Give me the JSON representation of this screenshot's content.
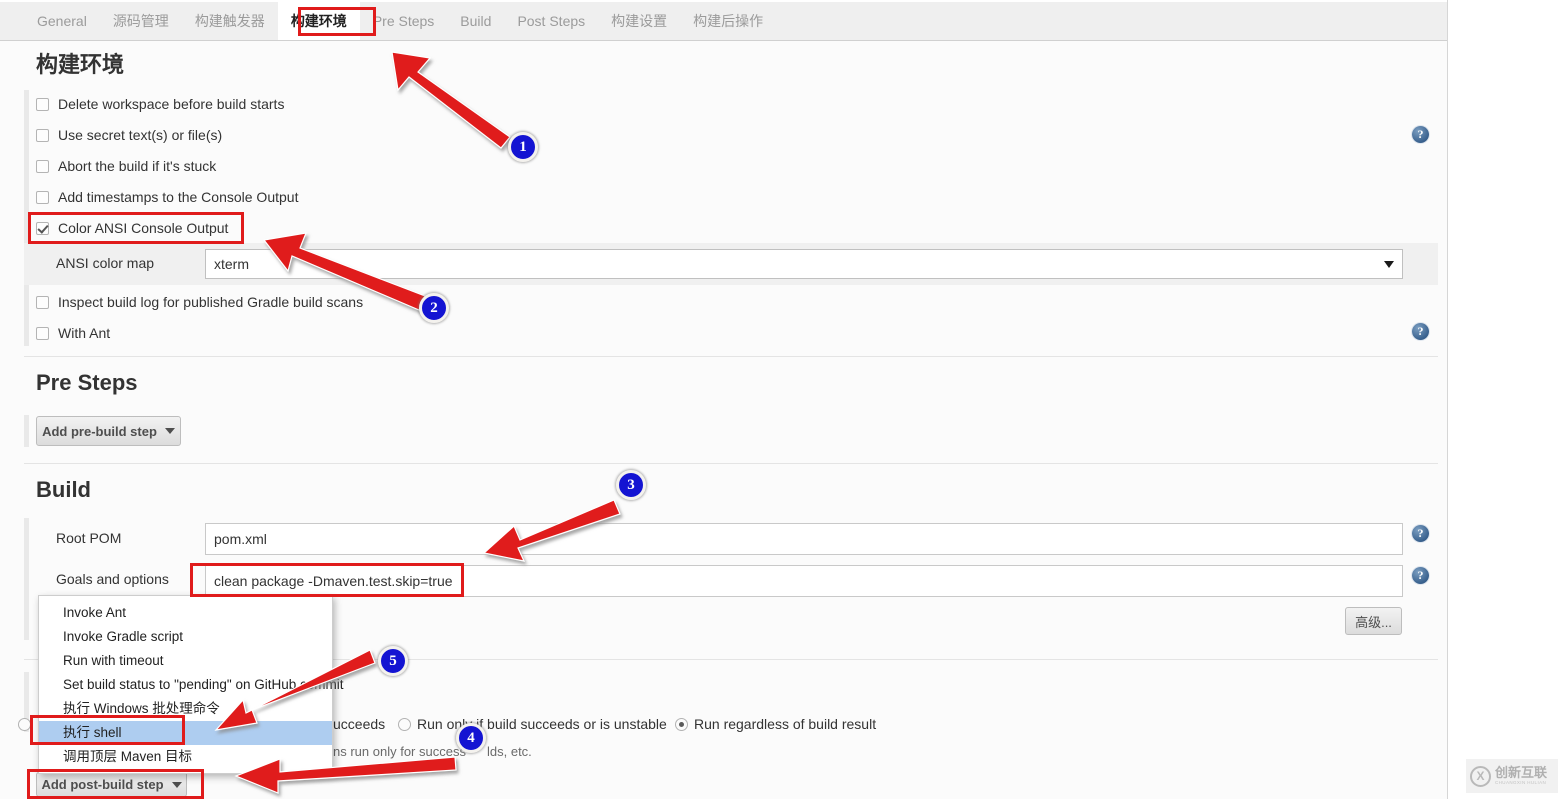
{
  "tabs": [
    {
      "label": "General",
      "selected": false
    },
    {
      "label": "源码管理",
      "selected": false
    },
    {
      "label": "构建触发器",
      "selected": false
    },
    {
      "label": "构建环境",
      "selected": true
    },
    {
      "label": "Pre Steps",
      "selected": false
    },
    {
      "label": "Build",
      "selected": false
    },
    {
      "label": "Post Steps",
      "selected": false
    },
    {
      "label": "构建设置",
      "selected": false
    },
    {
      "label": "构建后操作",
      "selected": false
    }
  ],
  "build_env": {
    "heading": "构建环境",
    "checkboxes": [
      {
        "label": "Delete workspace before build starts",
        "checked": false
      },
      {
        "label": "Use secret text(s) or file(s)",
        "checked": false
      },
      {
        "label": "Abort the build if it's stuck",
        "checked": false
      },
      {
        "label": "Add timestamps to the Console Output",
        "checked": false
      },
      {
        "label": "Color ANSI Console Output",
        "checked": true
      },
      {
        "label": "Inspect build log for published Gradle build scans",
        "checked": false
      },
      {
        "label": "With Ant",
        "checked": false
      }
    ],
    "ansi_color_map": {
      "label": "ANSI color map",
      "value": "xterm"
    },
    "help_icon": "?"
  },
  "pre_steps": {
    "heading": "Pre Steps",
    "add_button": "Add pre-build step"
  },
  "build": {
    "heading": "Build",
    "root_pom": {
      "label": "Root POM",
      "value": "pom.xml"
    },
    "goals": {
      "label": "Goals and options",
      "value": "clean package -Dmaven.test.skip=true"
    },
    "advanced_button": "高级..."
  },
  "post_steps": {
    "add_button": "Add post-build step",
    "radios": [
      {
        "label": "ucceeds",
        "checked": false,
        "partial": true
      },
      {
        "label": "Run only if build succeeds or is unstable",
        "checked": false
      },
      {
        "label": "Run regardless of build result",
        "checked": true
      }
    ],
    "hint_left": "ns run only for success",
    "hint_right": "lds, etc."
  },
  "dropdown_menu": {
    "items": [
      {
        "label": "Invoke Ant",
        "selected": false
      },
      {
        "label": "Invoke Gradle script",
        "selected": false
      },
      {
        "label": "Run with timeout",
        "selected": false
      },
      {
        "label": "Set build status to \"pending\" on GitHub commit",
        "selected": false
      },
      {
        "label": "执行 Windows 批处理命令",
        "selected": false
      },
      {
        "label": "执行 shell",
        "selected": true
      },
      {
        "label": "调用顶层 Maven 目标",
        "selected": false
      }
    ]
  },
  "annotations": {
    "badges": [
      "1",
      "2",
      "3",
      "4",
      "5"
    ],
    "highlight_color": "#e01b1b",
    "badge_color": "#1414d2"
  },
  "watermark": {
    "logo_letter": "X",
    "zh": "创新互联",
    "en": "CHUANGXIN HULIAN"
  }
}
